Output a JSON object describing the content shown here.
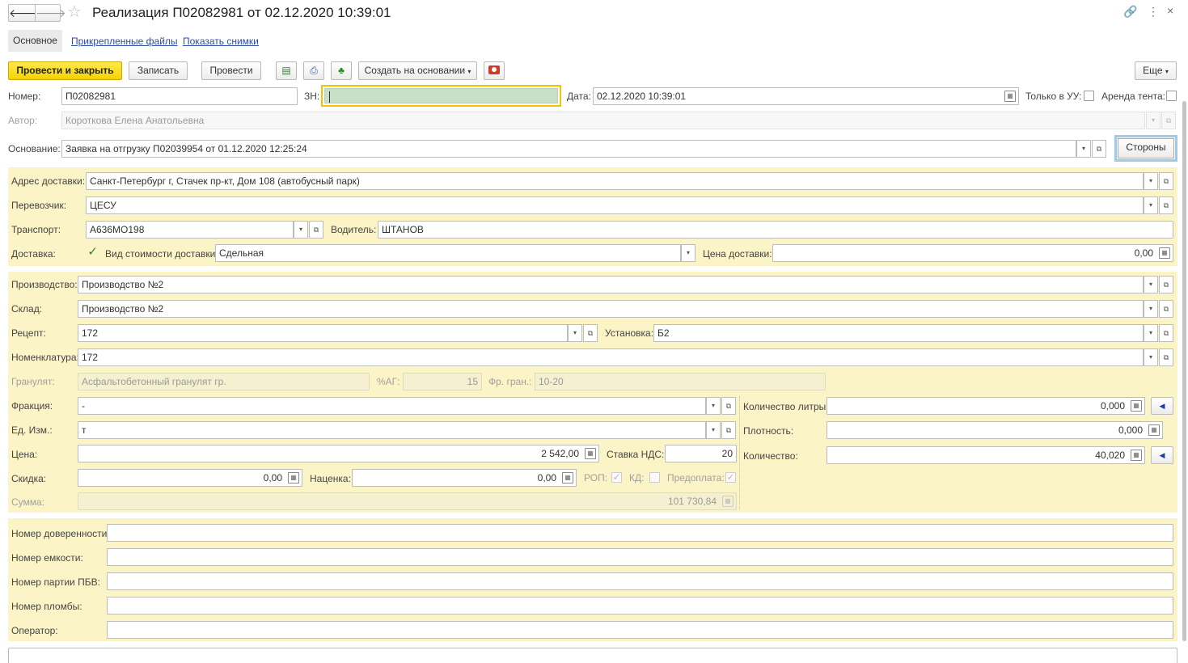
{
  "title": "Реализация П02082981 от 02.12.2020 10:39:01",
  "tabs": [
    "Основное",
    "Прикрепленные файлы",
    "Показать снимки"
  ],
  "toolbar": {
    "post_close": "Провести и закрыть",
    "save": "Записать",
    "post": "Провести",
    "create_based": "Создать на основании",
    "more": "Еще"
  },
  "header": {
    "number_label": "Номер:",
    "number_value": "П02082981",
    "zn_label": "ЗН:",
    "zn_value": "",
    "date_label": "Дата:",
    "date_value": "02.12.2020 10:39:01",
    "only_uu_label": "Только в УУ:",
    "tent_rent_label": "Аренда тента:",
    "author_label": "Автор:",
    "author_value": "Короткова Елена Анатольевна",
    "basis_label": "Основание:",
    "basis_value": "Заявка на отгрузку П02039954 от 01.12.2020 12:25:24",
    "sides_button": "Стороны"
  },
  "delivery": {
    "address_label": "Адрес доставки:",
    "address_value": "Санкт-Петербург г, Стачек пр-кт, Дом 108 (автобусный парк)",
    "carrier_label": "Перевозчик:",
    "carrier_value": "ЦЕСУ",
    "transport_label": "Транспорт:",
    "transport_value": "А636МО198",
    "driver_label": "Водитель:",
    "driver_value": "ШТАНОВ",
    "delivery_label": "Доставка:",
    "cost_type_label": "Вид стоимости доставки:",
    "cost_type_value": "Сдельная",
    "price_label": "Цена доставки:",
    "price_value": "0,00"
  },
  "production": {
    "production_label": "Производство:",
    "production_value": "Производство №2",
    "warehouse_label": "Склад:",
    "warehouse_value": "Производство №2",
    "recipe_label": "Рецепт:",
    "recipe_value": "172",
    "plant_label": "Установка:",
    "plant_value": "Б2",
    "nomenclature_label": "Номенклатура:",
    "nomenclature_value": "172",
    "granulate_label": "Гранулят:",
    "granulate_value": "Асфальтобетонный гранулят гр.",
    "ag_label": "%АГ:",
    "ag_value": "15",
    "fr_label": "Фр. гран.:",
    "fr_value": "10-20",
    "fraction_label": "Фракция:",
    "fraction_value": "-",
    "unit_label": "Ед. Изм.:",
    "unit_value": "т",
    "price_label": "Цена:",
    "price_value": "2 542,00",
    "vat_label": "Ставка НДС:",
    "vat_value": "20",
    "discount_label": "Скидка:",
    "discount_value": "0,00",
    "markup_label": "Наценка:",
    "markup_value": "0,00",
    "rop_label": "РОП:",
    "kd_label": "КД:",
    "prepay_label": "Предоплата:",
    "sum_label": "Сумма:",
    "sum_value": "101 730,84",
    "liters_label": "Количество литры:",
    "liters_value": "0,000",
    "density_label": "Плотность:",
    "density_value": "0,000",
    "quantity_label": "Количество:",
    "quantity_value": "40,020"
  },
  "extra": {
    "poa_label": "Номер доверенности:",
    "container_label": "Номер емкости:",
    "batch_label": "Номер партии ПБВ:",
    "seal_label": "Номер пломбы:",
    "operator_label": "Оператор:"
  },
  "colors": {
    "accent_yellow": "#f5d300",
    "panel": "#fbf4c6",
    "zn_fill": "#c8e0c8"
  }
}
